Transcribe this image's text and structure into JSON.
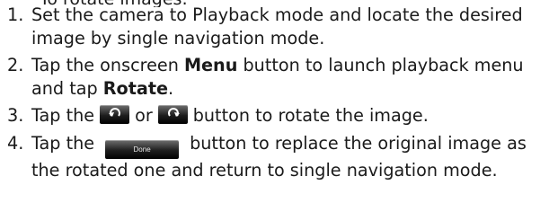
{
  "partial_heading": "To rotate images:",
  "steps": [
    {
      "number": "1.",
      "text": "Set the camera to Playback mode and locate the desired image by single navigation mode."
    },
    {
      "number": "2.",
      "text_before_menu": "Tap the onscreen ",
      "menu_label": "Menu",
      "text_middle": " button to launch playback menu and tap ",
      "rotate_label": "Rotate",
      "text_end": "."
    },
    {
      "number": "3.",
      "text_before": "Tap the",
      "text_or": "or",
      "text_after": "button to rotate the image.",
      "icons": [
        "rotate-left-icon",
        "rotate-right-icon"
      ]
    },
    {
      "number": "4.",
      "text_before": "Tap the",
      "done_button_label": "Done",
      "text_after": "button to replace the original image as the rotated one and return to single navigation mode."
    }
  ],
  "colors": {
    "text": "#1a1a1a",
    "button_dark": "#1e1e1e"
  }
}
